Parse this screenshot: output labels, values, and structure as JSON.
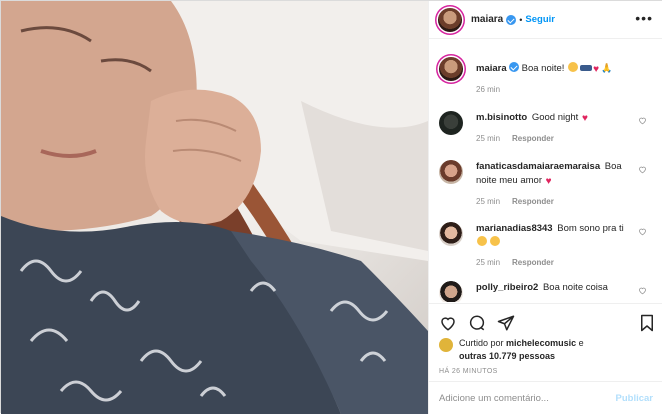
{
  "post": {
    "username": "maiara",
    "follow_label": "Seguir",
    "separator": "•",
    "caption": "Boa noite!",
    "caption_age": "26 min",
    "comments": [
      {
        "user": "m.bisinotto",
        "text": "Good night",
        "emoji": "heart",
        "age": "25 min",
        "reply": "Responder"
      },
      {
        "user": "fanaticasdamaiaraemaraisa",
        "text": "Boa noite meu amor",
        "emoji": "heart",
        "age": "25 min",
        "reply": "Responder"
      },
      {
        "user": "marianadias8343",
        "text": "Bom sono pra ti",
        "emoji": "faces",
        "age": "25 min",
        "reply": "Responder"
      },
      {
        "user": "polly_ribeiro2",
        "text": "Boa noite coisa",
        "emoji": "",
        "age": "",
        "reply": ""
      }
    ],
    "likes_prefix": "Curtido por",
    "liked_by": "michelecomusic",
    "likes_joiner": "e",
    "likes_others": "outras 10.779 pessoas",
    "timestamp": "HÁ 26 MINUTOS",
    "comment_placeholder": "Adicione um comentário...",
    "publish_label": "Publicar"
  },
  "colors": {
    "link": "#0095f6",
    "verified": "#3897f0",
    "heart": "#e0245e",
    "muted": "#8e8e8e"
  },
  "icons": [
    "more-icon",
    "verified-badge-icon",
    "heart-icon",
    "comment-icon",
    "share-icon",
    "bookmark-icon"
  ]
}
